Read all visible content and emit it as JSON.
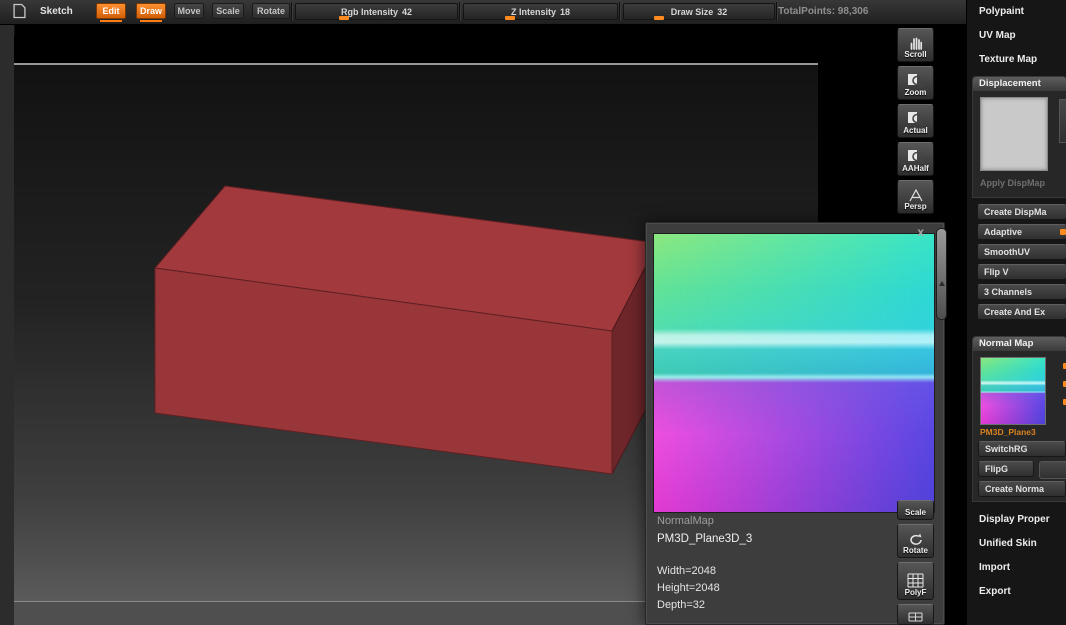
{
  "colors": {
    "accent_orange": "#ff8a1e",
    "box_red_front": "#983639",
    "box_red_top": "#a23a3d",
    "box_red_side": "#6e262a"
  },
  "topbar": {
    "sketch_label": "Sketch",
    "modes": [
      {
        "label": "Edit",
        "active": true
      },
      {
        "label": "Draw",
        "active": true
      },
      {
        "label": "Move",
        "active": false
      },
      {
        "label": "Scale",
        "active": false
      },
      {
        "label": "Rotate",
        "active": false
      }
    ],
    "sliders": [
      {
        "label": "Rgb Intensity",
        "value": "42"
      },
      {
        "label": "Z Intensity",
        "value": "18"
      },
      {
        "label": "Draw Size",
        "value": "32"
      }
    ],
    "total_points": "TotalPoints:  98,306"
  },
  "side_tools": {
    "top": [
      {
        "label": "Scroll"
      },
      {
        "label": "Zoom"
      },
      {
        "label": "Actual"
      },
      {
        "label": "AAHalf"
      },
      {
        "label": "Persp"
      }
    ],
    "bottom": [
      {
        "label": "Scale"
      },
      {
        "label": "Rotate"
      },
      {
        "label": "PolyF"
      }
    ]
  },
  "popup": {
    "name": "NormalMap",
    "object": "PM3D_Plane3D_3",
    "width_line": "Width=2048",
    "height_line": "Height=2048",
    "depth_line": "Depth=32",
    "close": "x"
  },
  "right_panel": {
    "sections_top": [
      "Polypaint",
      "UV Map",
      "Texture Map"
    ],
    "displacement": {
      "header": "Displacement",
      "apply_label": "Apply DispMap",
      "buttons": [
        "Create DispMa",
        "Adaptive",
        "SmoothUV",
        "Flip V",
        "3 Channels",
        "Create And Ex"
      ]
    },
    "normal_map": {
      "header": "Normal Map",
      "thumb_label": "PM3D_Plane3",
      "buttons": [
        "SwitchRG",
        "FlipG",
        "Create Norma"
      ]
    },
    "sections_bottom": [
      "Display Proper",
      "Unified Skin",
      "Import",
      "Export"
    ]
  }
}
